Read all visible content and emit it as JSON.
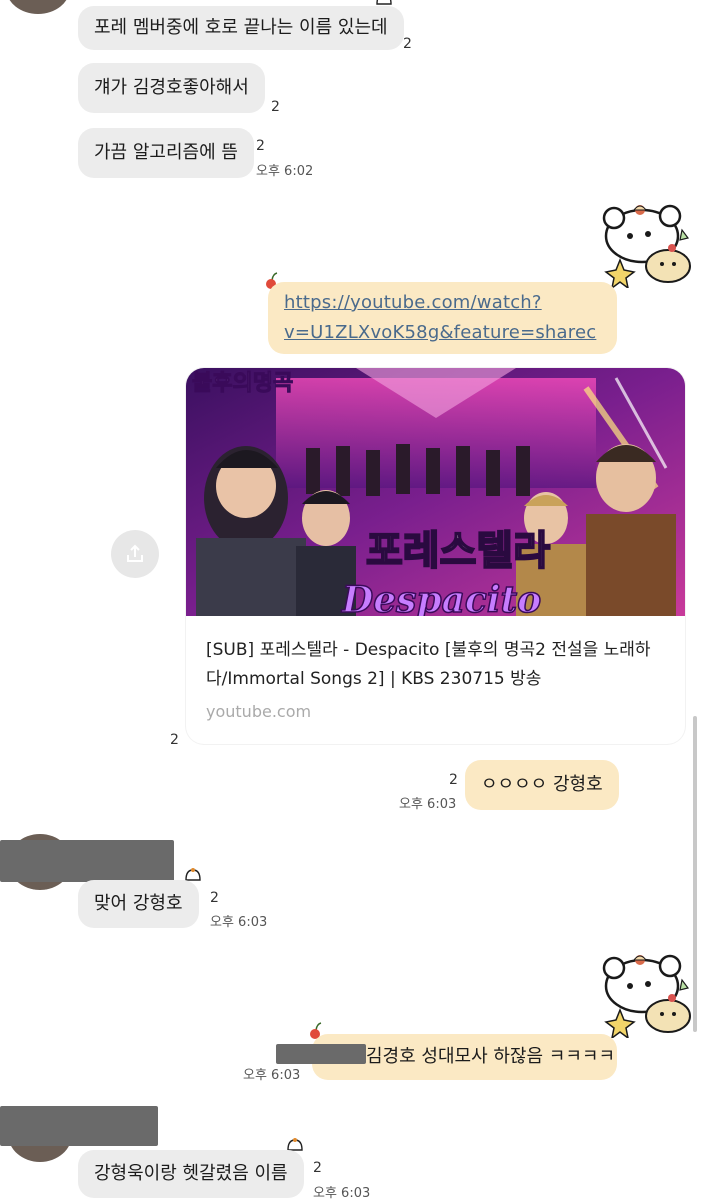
{
  "messages": {
    "m1": {
      "text": "포레 멤버중에 호로 끝나는 이름 있는데",
      "unread": "2"
    },
    "m2": {
      "text": "걔가 김경호좋아해서",
      "unread": "2"
    },
    "m3": {
      "text": "가끔 알고리즘에 뜸",
      "unread": "2",
      "time": "오후 6:02"
    },
    "m4": {
      "link_line1": "https://youtube.com/watch?",
      "link_line2": "v=U1ZLXvoK58g&feature=sharec"
    },
    "preview": {
      "title": "[SUB] 포레스텔라 - Despacito [불후의 명곡2 전설을 노래하다/Immortal Songs 2] | KBS 230715 방송",
      "site": "youtube.com",
      "thumb_logo": "불후의명곡",
      "thumb_group": "포레스텔라",
      "thumb_song": "Despacito",
      "unread": "2"
    },
    "m5": {
      "text": "ㅇㅇㅇㅇ 강형호",
      "unread": "2",
      "time": "오후 6:03"
    },
    "m6": {
      "text": "맞어 강형호",
      "unread": "2",
      "time": "오후 6:03"
    },
    "m7": {
      "text": "김경호 성대모사 하잖음 ㅋㅋㅋㅋ",
      "time": "오후 6:03"
    },
    "m8": {
      "text": "강형욱이랑 헷갈렸음 이름",
      "unread": "2",
      "time": "오후 6:03"
    }
  },
  "icons": {
    "share": "share-icon",
    "sticker": "bear-cat-sticker-icon",
    "cherry": "cherry-icon",
    "bell": "bell-icon"
  },
  "colors": {
    "incoming_bubble": "#ececec",
    "outgoing_bubble": "#fbe9c4",
    "link": "#4a6a8c"
  }
}
